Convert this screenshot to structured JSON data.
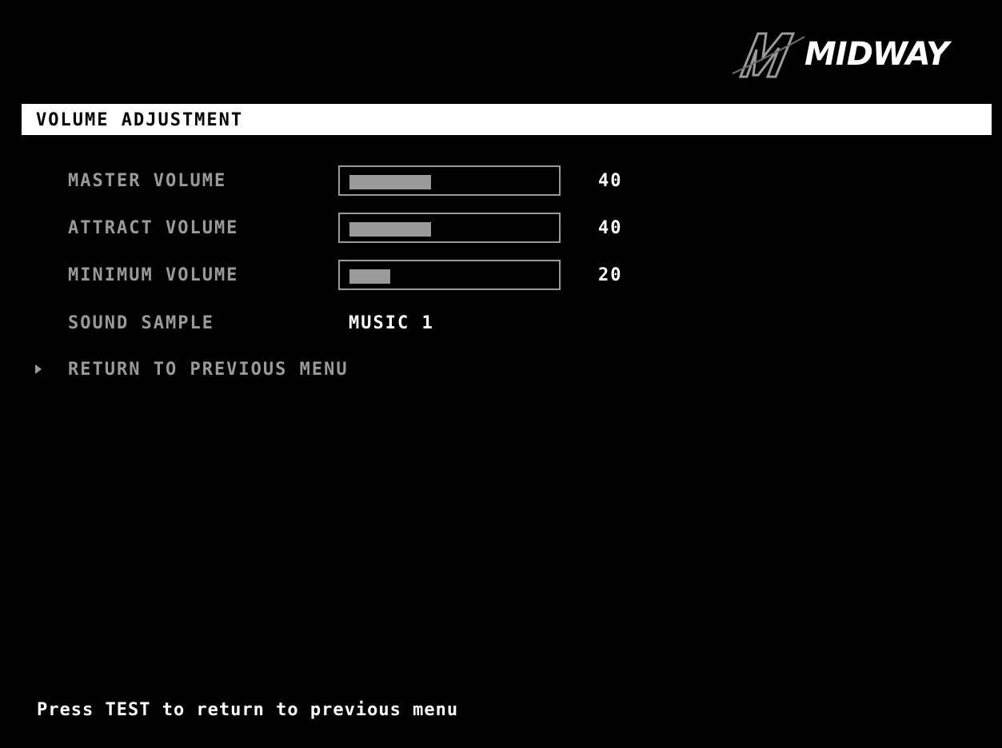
{
  "brand": {
    "logo_text": "MIDWAY",
    "logo_icon": "midway-m-emblem-icon"
  },
  "screen": {
    "title": "VOLUME ADJUSTMENT"
  },
  "settings": [
    {
      "label": "MASTER VOLUME",
      "value": "40",
      "level": 0.4
    },
    {
      "label": "ATTRACT VOLUME",
      "value": "40",
      "level": 0.4
    },
    {
      "label": "MINIMUM VOLUME",
      "value": "20",
      "level": 0.2
    }
  ],
  "sound_sample": {
    "label": "SOUND SAMPLE",
    "value": "MUSIC 1"
  },
  "menu": {
    "cursor_icon": "triangle-right-icon",
    "return_label": "RETURN TO PREVIOUS MENU"
  },
  "footer": {
    "hint": "Press TEST to return to previous menu"
  },
  "colors": {
    "background": "#000000",
    "text_dim": "#9a9a9a",
    "text_bright": "#ffffff",
    "title_bar": "#ffffff"
  }
}
